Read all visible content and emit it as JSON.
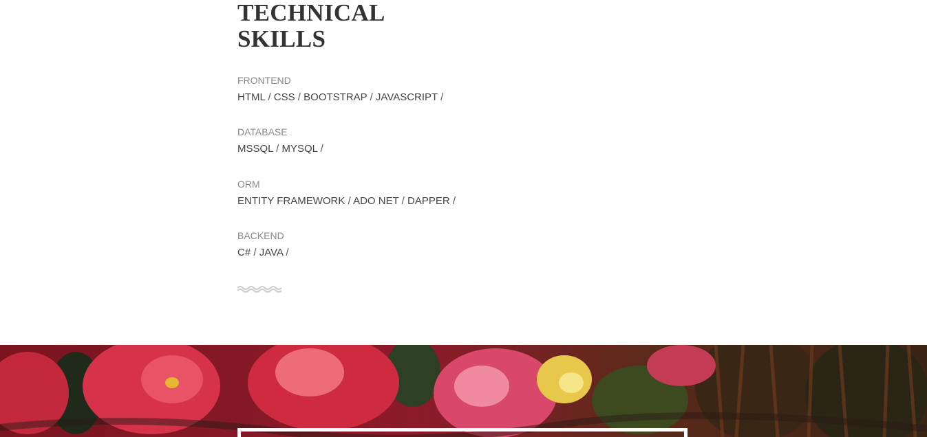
{
  "skills": {
    "title_line1": "TECHNICAL",
    "title_line2": "SKILLS",
    "groups": [
      {
        "category": "FRONTEND",
        "items": [
          "HTML",
          "CSS",
          "BOOTSTRAP",
          "JAVASCRIPT"
        ]
      },
      {
        "category": "DATABASE",
        "items": [
          "MSSQL",
          "MYSQL"
        ]
      },
      {
        "category": "ORM",
        "items": [
          "ENTITY FRAMEWORK",
          "ADO NET",
          "DAPPER"
        ]
      },
      {
        "category": "BACKEND",
        "items": [
          "C#",
          "JAVA"
        ]
      }
    ]
  },
  "decor": {
    "divider_icon": "wave-divider-icon",
    "divider_color": "#cccccc",
    "banner_image": "floral-painting-banner"
  },
  "colors": {
    "heading": "#333333",
    "category": "#888888",
    "text": "#444444"
  }
}
